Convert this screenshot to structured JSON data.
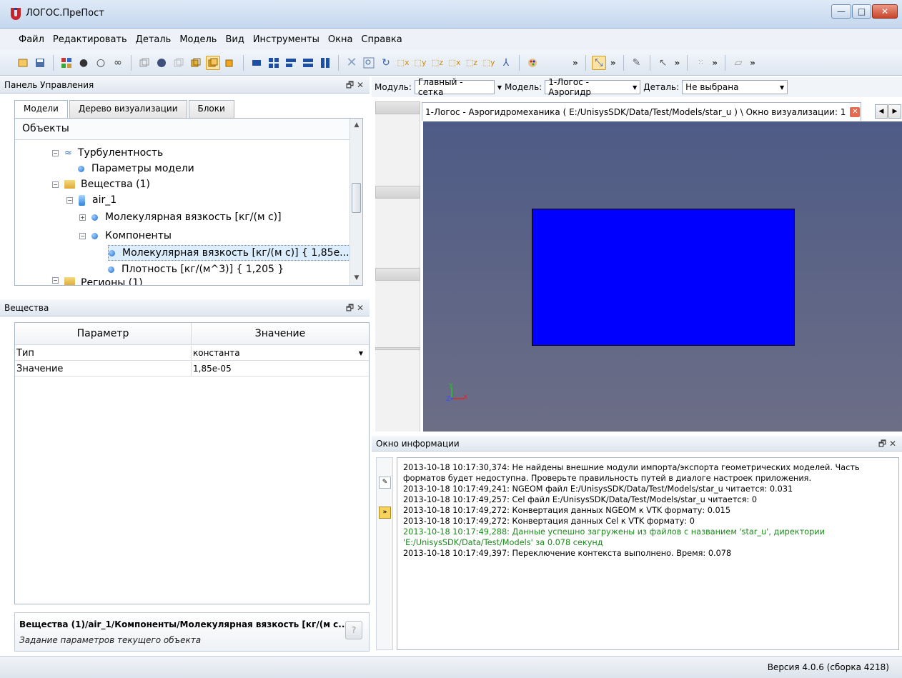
{
  "window": {
    "title": "ЛОГОС.ПреПост",
    "min_glyph": "—",
    "max_glyph": "□",
    "close_glyph": "✕"
  },
  "menu": [
    "Файл",
    "Редактировать",
    "Деталь",
    "Модель",
    "Вид",
    "Инструменты",
    "Окна",
    "Справка"
  ],
  "toolbar": {
    "more": "»"
  },
  "control_panel": {
    "title": "Панель Управления",
    "dock_controls": "🗗 ✕",
    "tabs": [
      "Модели",
      "Дерево визуализации",
      "Блоки"
    ],
    "tree_header": "Объекты",
    "tree": {
      "turbulence": "Турбулентность",
      "model_params": "Параметры модели",
      "substances": "Вещества (1)",
      "air": "air_1",
      "mol_viscosity": "Молекулярная вязкость [кг/(м с)]",
      "components": "Компоненты",
      "comp_viscosity": "Молекулярная вязкость [кг/(м с)] { 1,85e...",
      "density": "Плотность [кг/(м^3)] { 1,205 }",
      "regions": "Регионы (1)"
    }
  },
  "substances_panel": {
    "title": "Вещества",
    "dock_controls": "🗗 ✕",
    "columns": [
      "Параметр",
      "Значение"
    ],
    "rows": [
      {
        "param": "Тип",
        "value": "константа"
      },
      {
        "param": "Значение",
        "value": "1,85e-05"
      }
    ]
  },
  "help": {
    "path": "Вещества (1)/air_1/Компоненты/Молекулярная вязкость [кг/(м с...",
    "description": "Задание параметров текущего объекта",
    "button": "?"
  },
  "module_bar": {
    "module_label": "Модуль:",
    "module_value": "Главный - сетка",
    "model_label": "Модель:",
    "model_value": "1-Логос - Аэрогидр",
    "detail_label": "Деталь:",
    "detail_value": "Не выбрана"
  },
  "view_tab": {
    "title": "1-Логос - Аэрогидромеханика  ( E:/UnisysSDK/Data/Test/Models/star_u ) \\ Окно визуализации: 1"
  },
  "axes": {
    "y": "Y",
    "z": "Z",
    "x": "X"
  },
  "info_window": {
    "title": "Окно информации",
    "dock_controls": "🗗 ✕",
    "log": [
      {
        "text": "2013-10-18 10:17:30,374: Не найдены внешние модули импорта/экспорта геометрических моделей. Часть форматов будет недоступна. Проверьте правильность путей в диалоге настроек приложения.",
        "green": false
      },
      {
        "text": "2013-10-18 10:17:49,241: NGEOM файл E:/UnisysSDK/Data/Test/Models/star_u читается: 0.031",
        "green": false
      },
      {
        "text": "2013-10-18 10:17:49,257: Cel файл E:/UnisysSDK/Data/Test/Models/star_u читается: 0",
        "green": false
      },
      {
        "text": "2013-10-18 10:17:49,272: Конвертация данных NGEOM к VTK формату: 0.015",
        "green": false
      },
      {
        "text": "2013-10-18 10:17:49,272: Конвертация данных Cel к VTK формату: 0",
        "green": false
      },
      {
        "text": "2013-10-18 10:17:49,288: Данные успешно загружены из файлов с названием 'star_u', директории 'E:/UnisysSDK/Data/Test/Models' за 0.078 секунд",
        "green": true
      },
      {
        "text": "2013-10-18 10:17:49,397: Переключение контекста выполнено. Время: 0.078",
        "green": false
      }
    ]
  },
  "status": {
    "version": "Версия 4.0.6 (сборка 4218)"
  },
  "colors": {
    "mesh": "#0000ff",
    "viewport_top": "#4e5b86",
    "log_green": "#1b8a1b"
  }
}
